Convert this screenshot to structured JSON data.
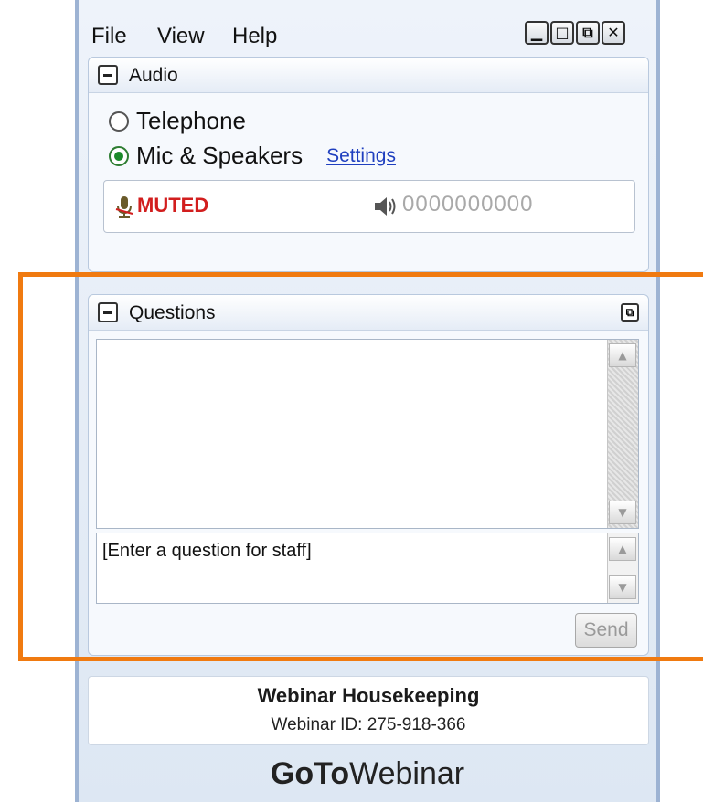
{
  "menu": {
    "file": "File",
    "view": "View",
    "help": "Help"
  },
  "window_controls": {
    "minimize": "▁",
    "maximize": "□",
    "restore": "⧉",
    "close": "✕"
  },
  "audio": {
    "title": "Audio",
    "telephone_label": "Telephone",
    "mic_label": "Mic & Speakers",
    "settings_link": "Settings",
    "selected": "mic",
    "status": "MUTED",
    "level_meter": "0000000000"
  },
  "questions": {
    "title": "Questions",
    "input_placeholder": "[Enter a question for staff]",
    "send_label": "Send"
  },
  "footer": {
    "title": "Webinar Housekeeping",
    "webinar_id": "Webinar ID: 275-918-366",
    "brand_bold": "GoTo",
    "brand_regular": "Webinar"
  },
  "colors": {
    "muted": "#d21e1e",
    "link": "#1f3fbf",
    "highlight": "#f07a10",
    "radio_selected": "#1b8a2a"
  }
}
